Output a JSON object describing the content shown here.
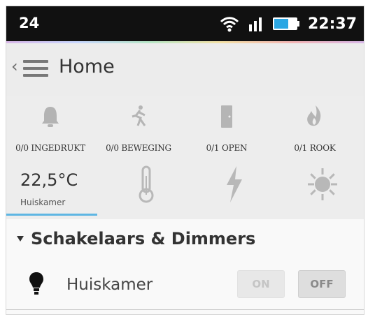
{
  "statusbar": {
    "left_value": "24",
    "time": "22:37",
    "icons": [
      "wifi-icon",
      "signal-icon",
      "battery-icon"
    ]
  },
  "header": {
    "title": "Home",
    "icons": [
      "chevron-left-icon",
      "menu-icon"
    ]
  },
  "sensors": [
    {
      "label": "0/0 INGEDRUKT",
      "icon": "bell-icon"
    },
    {
      "label": "0/0 BEWEGING",
      "icon": "running-person-icon"
    },
    {
      "label": "0/1 OPEN",
      "icon": "door-icon"
    },
    {
      "label": "0/1 ROOK",
      "icon": "flame-icon"
    }
  ],
  "metrics": {
    "temperature": "22,5°C",
    "room": "Huiskamer",
    "icons": [
      "thermometer-icon",
      "lightning-icon",
      "sun-icon"
    ]
  },
  "section": {
    "title": "Schakelaars & Dimmers",
    "row": {
      "label": "Huiskamer",
      "on_label": "ON",
      "off_label": "OFF",
      "icon": "light-bulb-icon"
    }
  },
  "colors": {
    "accent": "#5eb6e3",
    "status_bar": "#111111",
    "background": "#ededed",
    "icon_gray": "#b5b5b5"
  }
}
